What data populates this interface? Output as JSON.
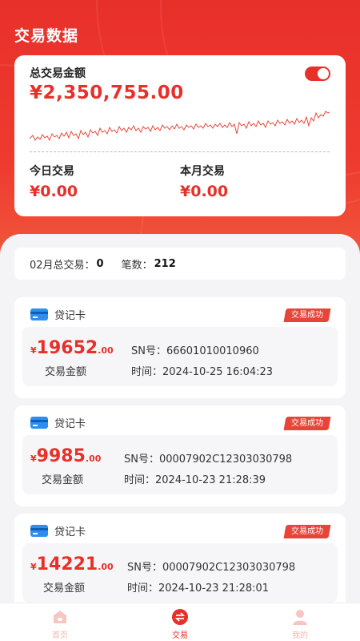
{
  "header": {
    "title": "交易数据"
  },
  "summary": {
    "label": "总交易金额",
    "amount": "¥2,350,755.00",
    "today_label": "今日交易",
    "today_value": "¥0.00",
    "month_label": "本月交易",
    "month_value": "¥0.00"
  },
  "month_summary": {
    "label": "02月总交易：",
    "total": "0",
    "count_label": "笔数：",
    "count": "212"
  },
  "transactions": [
    {
      "card_type": "贷记卡",
      "status": "交易成功",
      "currency": "¥",
      "amount_int": "19652",
      "amount_dec": ".00",
      "amount_label": "交易金额",
      "sn": "SN号：66601010010960",
      "time": "时间：2024-10-25 16:04:23"
    },
    {
      "card_type": "贷记卡",
      "status": "交易成功",
      "currency": "¥",
      "amount_int": "9985",
      "amount_dec": ".00",
      "amount_label": "交易金额",
      "sn": "SN号：00007902C12303030798",
      "time": "时间：2024-10-23 21:28:39"
    },
    {
      "card_type": "贷记卡",
      "status": "交易成功",
      "currency": "¥",
      "amount_int": "14221",
      "amount_dec": ".00",
      "amount_label": "交易金额",
      "sn": "SN号：00007902C12303030798",
      "time": "时间：2024-10-23 21:28:01"
    }
  ],
  "tabbar": {
    "home": "首页",
    "trade": "交易",
    "mine": "我的"
  },
  "colors": {
    "accent": "#e8302a",
    "card_icon": "#2d8ef0"
  }
}
